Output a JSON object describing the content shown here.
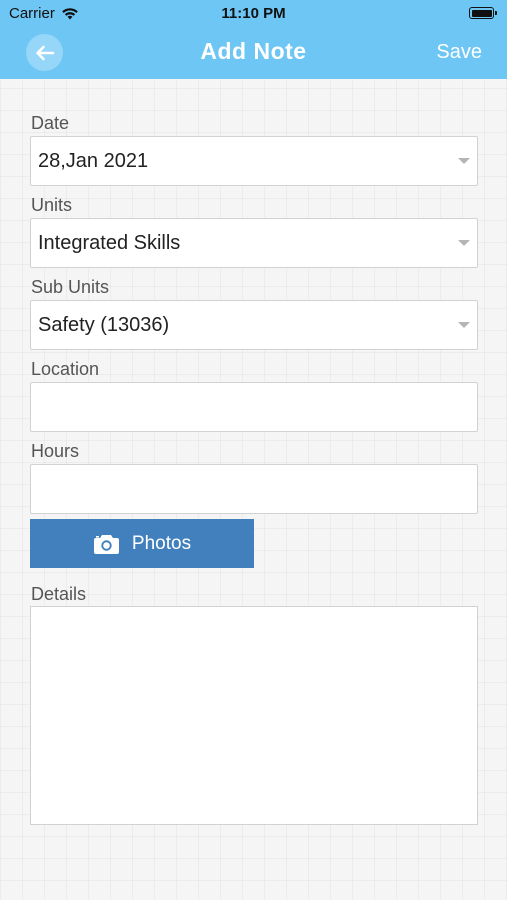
{
  "status_bar": {
    "carrier": "Carrier",
    "time": "11:10 PM"
  },
  "header": {
    "title": "Add Note",
    "save_label": "Save",
    "accent_color": "#6ec6f5"
  },
  "form": {
    "date": {
      "label": "Date",
      "value": "28,Jan 2021"
    },
    "units": {
      "label": "Units",
      "value": "Integrated Skills"
    },
    "sub_units": {
      "label": "Sub Units",
      "value": "Safety (13036)"
    },
    "location": {
      "label": "Location",
      "value": ""
    },
    "hours": {
      "label": "Hours",
      "value": ""
    },
    "photos_button": {
      "label": "Photos",
      "icon": "camera-icon",
      "color": "#4180bd"
    },
    "details": {
      "label": "Details",
      "value": ""
    }
  }
}
